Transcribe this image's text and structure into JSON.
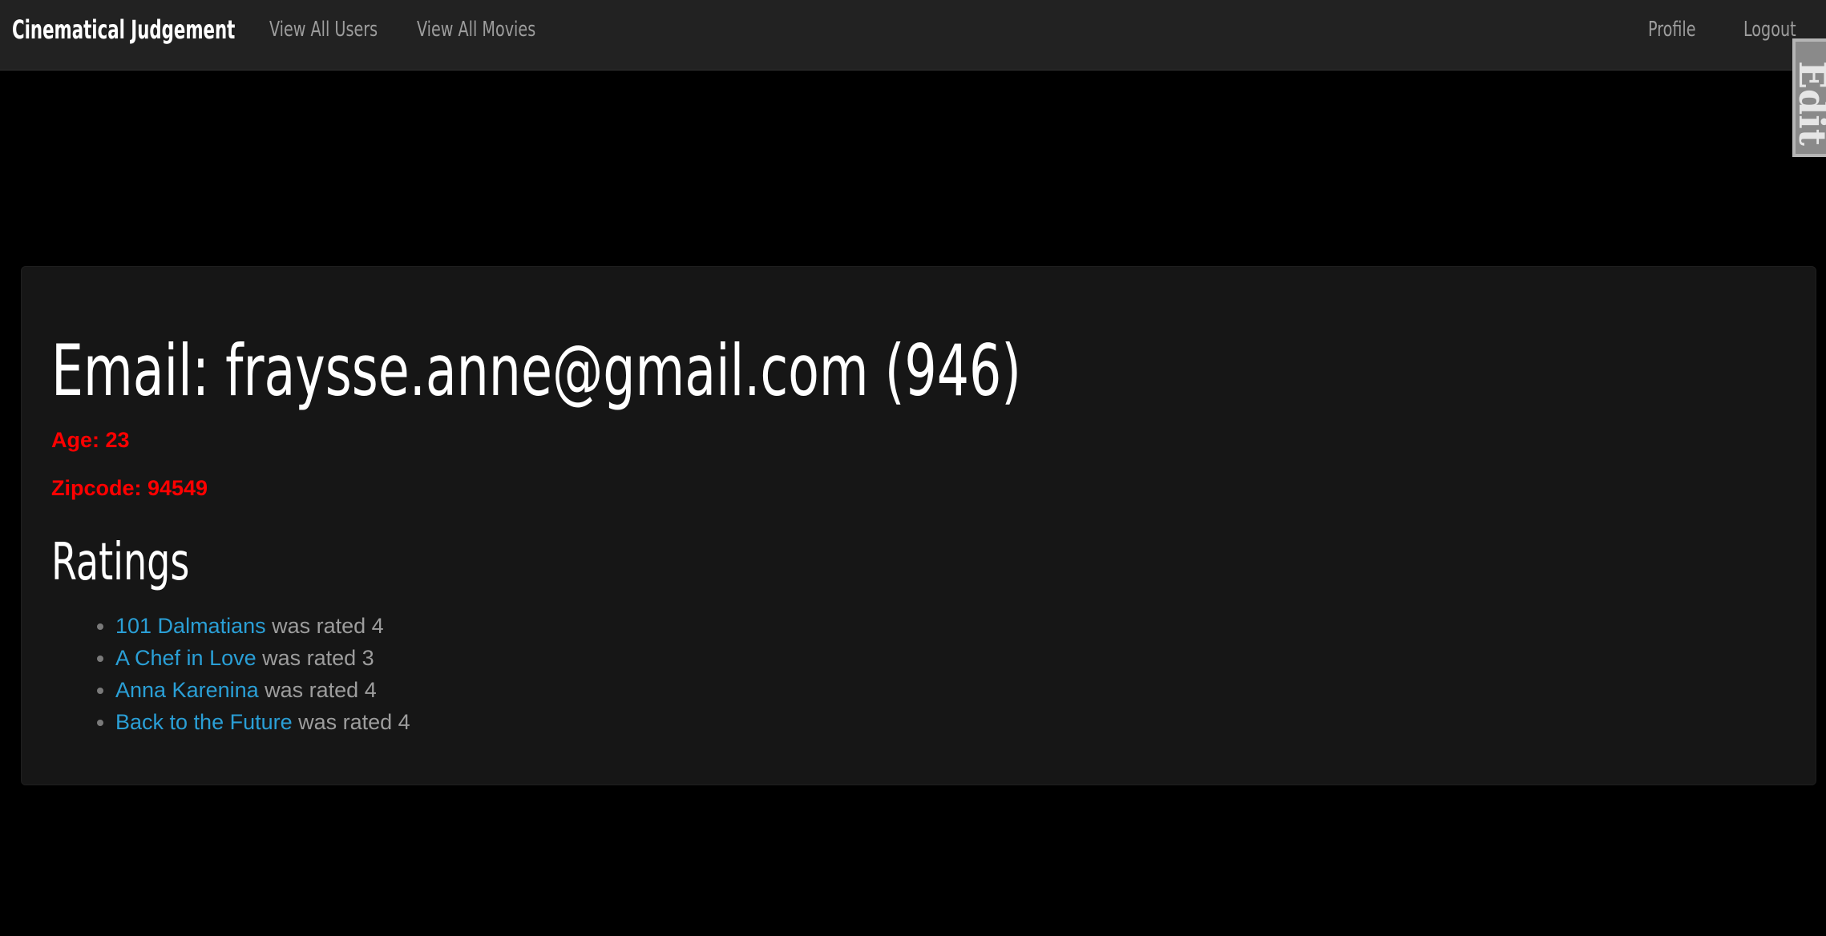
{
  "navbar": {
    "brand": "Cinematical Judgement",
    "links": {
      "view_all_users": "View All Users",
      "view_all_movies": "View All Movies",
      "profile": "Profile",
      "logout": "Logout"
    }
  },
  "edit_tab": {
    "label": "Edit"
  },
  "user": {
    "email_heading": "Email: fraysse.anne@gmail.com (946)",
    "age": "Age: 23",
    "zipcode": "Zipcode: 94549"
  },
  "ratings": {
    "heading": "Ratings",
    "items": [
      {
        "movie": "101 Dalmatians",
        "text": " was rated 4"
      },
      {
        "movie": "A Chef in Love",
        "text": " was rated 3"
      },
      {
        "movie": "Anna Karenina",
        "text": " was rated 4"
      },
      {
        "movie": "Back to the Future",
        "text": " was rated 4"
      }
    ]
  },
  "colors": {
    "page_background": "#000000",
    "navbar_background": "#222222",
    "panel_background": "#161616",
    "link_blue": "#2a9fd6",
    "muted_text": "#9d9d9d",
    "alert_red": "#ff0000",
    "heading_white": "#ffffff"
  }
}
